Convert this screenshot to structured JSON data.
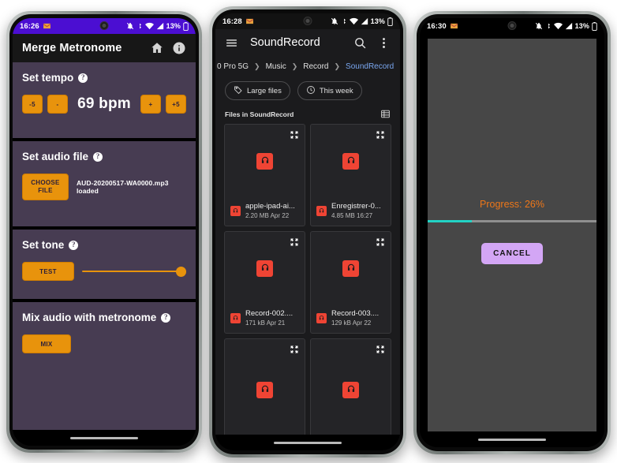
{
  "colors": {
    "accent_orange": "#e8930c",
    "card_purple": "#473c52",
    "status_purple": "#4b0ed2",
    "crumb_blue": "#7aa7f0",
    "audio_red": "#ef4434",
    "progress_teal": "#22d3c5",
    "progress_text": "#ee7719",
    "cancel_purple": "#d3a6f5"
  },
  "phone1": {
    "status": {
      "time": "16:26",
      "battery_percent": "13%"
    },
    "appbar": {
      "title": "Merge Metronome",
      "home_icon": "home-icon",
      "info_icon": "info-icon"
    },
    "sections": [
      {
        "title": "Set tempo",
        "buttons": {
          "minus5": "-5",
          "minus": "-",
          "plus": "+",
          "plus5": "+5"
        },
        "bpm": "69 bpm"
      },
      {
        "title": "Set audio file",
        "choose_label": "CHOOSE FILE",
        "file_status": "AUD-20200517-WA0000.mp3 loaded"
      },
      {
        "title": "Set tone",
        "test_label": "TEST",
        "slider_value": 100
      },
      {
        "title": "Mix audio with metronome",
        "mix_label": "MIX"
      }
    ]
  },
  "phone2": {
    "status": {
      "time": "16:28",
      "battery_percent": "13%"
    },
    "appbar": {
      "title": "SoundRecord",
      "menu_icon": "hamburger-icon",
      "search_icon": "search-icon",
      "overflow_icon": "more-vertical-icon"
    },
    "breadcrumb": [
      "0 Pro 5G",
      "Music",
      "Record",
      "SoundRecord"
    ],
    "chips": [
      {
        "label": "Large files",
        "icon": "tag-icon"
      },
      {
        "label": "This week",
        "icon": "clock-icon"
      }
    ],
    "files_header": {
      "label": "Files in SoundRecord",
      "view_icon": "list-view-icon"
    },
    "files": [
      {
        "name": "apple-ipad-ai...",
        "size": "2.20 MB",
        "date": "Apr 22"
      },
      {
        "name": "Enregistrer-0...",
        "size": "4.85 MB",
        "date": "16:27"
      },
      {
        "name": "Record-002....",
        "size": "171 kB",
        "date": "Apr 21"
      },
      {
        "name": "Record-003....",
        "size": "129 kB",
        "date": "Apr 22"
      },
      {
        "name": "",
        "size": "",
        "date": ""
      },
      {
        "name": "",
        "size": "",
        "date": ""
      }
    ]
  },
  "phone3": {
    "status": {
      "time": "16:30",
      "battery_percent": "13%"
    },
    "dialog": {
      "progress_label": "Progress: 26%",
      "progress_percent": 26,
      "cancel_label": "CANCEL"
    }
  }
}
